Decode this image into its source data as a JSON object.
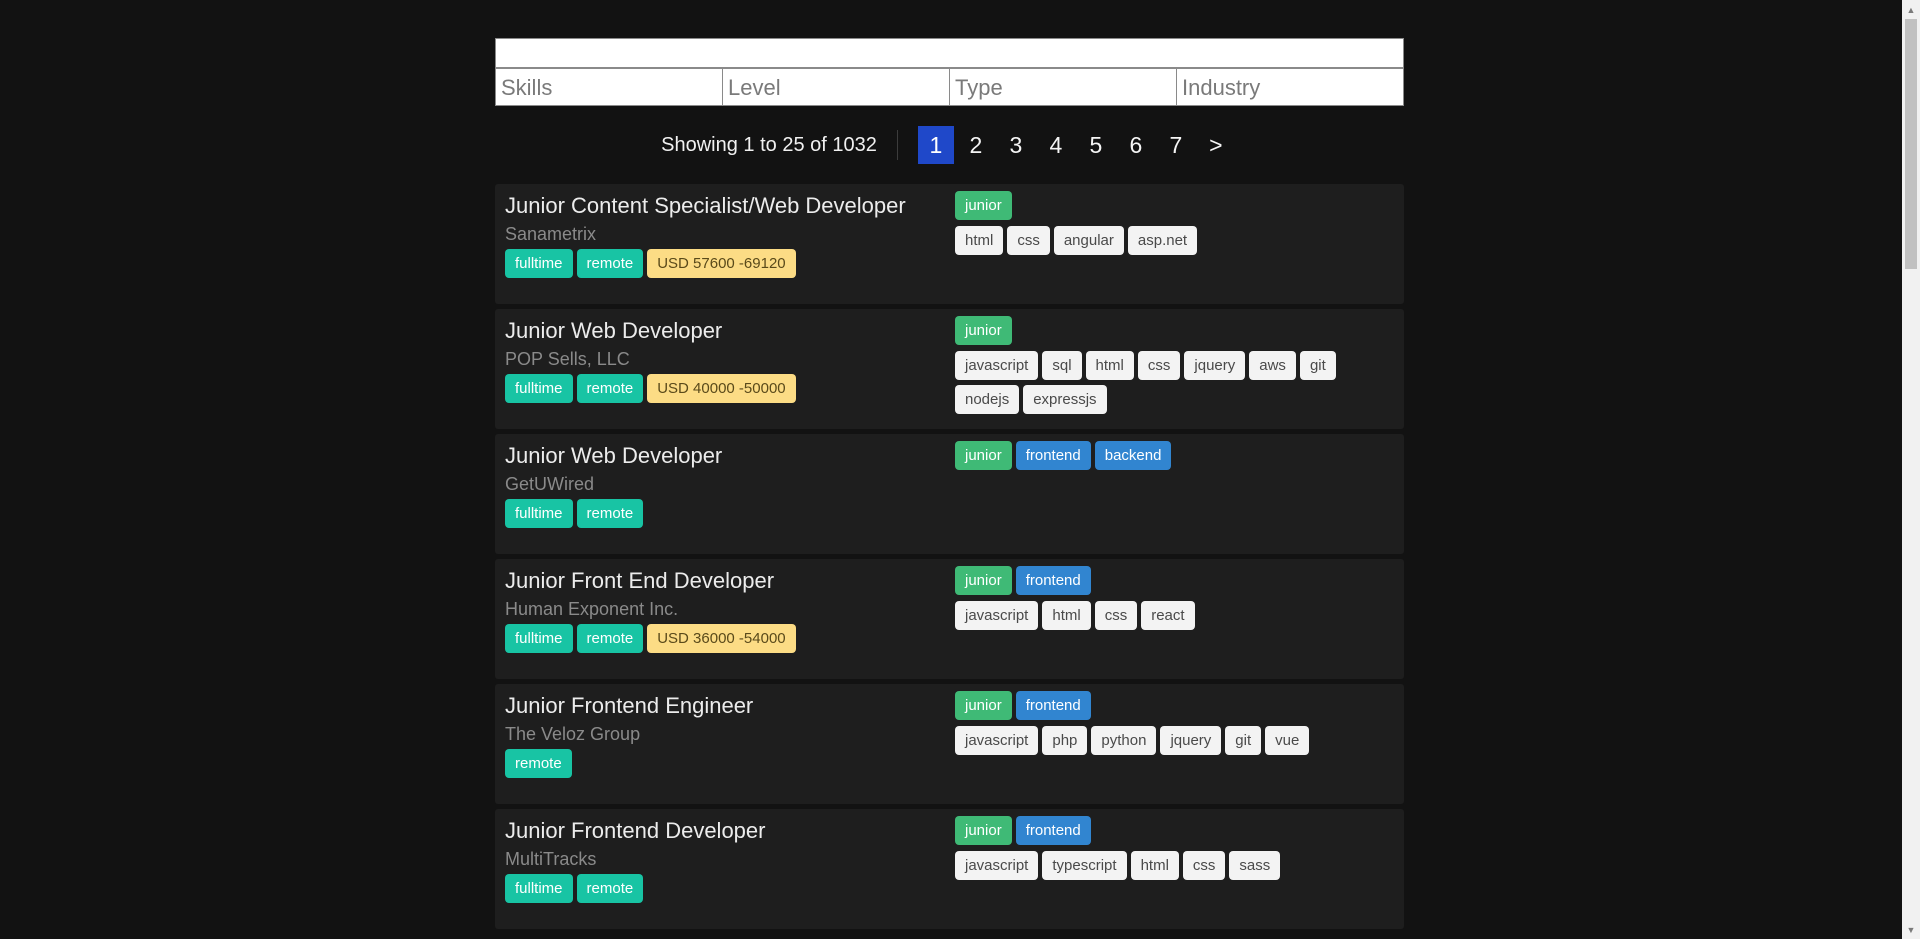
{
  "search": {
    "value": "",
    "placeholder": ""
  },
  "filters": [
    {
      "label": "Skills"
    },
    {
      "label": "Level"
    },
    {
      "label": "Type"
    },
    {
      "label": "Industry"
    }
  ],
  "pagination": {
    "showing": "Showing 1 to 25 of 1032",
    "pages": [
      "1",
      "2",
      "3",
      "4",
      "5",
      "6",
      "7"
    ],
    "current": "1",
    "next": ">"
  },
  "jobs": [
    {
      "title": "Junior Content Specialist/Web Developer",
      "company": "Sanametrix",
      "types": [
        "fulltime",
        "remote"
      ],
      "salary": "USD 57600 -69120",
      "levels": [
        "junior"
      ],
      "roles": [],
      "skills": [
        "html",
        "css",
        "angular",
        "asp.net"
      ]
    },
    {
      "title": "Junior Web Developer",
      "company": "POP Sells, LLC",
      "types": [
        "fulltime",
        "remote"
      ],
      "salary": "USD 40000 -50000",
      "levels": [
        "junior"
      ],
      "roles": [],
      "skills": [
        "javascript",
        "sql",
        "html",
        "css",
        "jquery",
        "aws",
        "git",
        "nodejs",
        "expressjs"
      ]
    },
    {
      "title": "Junior Web Developer",
      "company": "GetUWired",
      "types": [
        "fulltime",
        "remote"
      ],
      "salary": "",
      "levels": [
        "junior"
      ],
      "roles": [
        "frontend",
        "backend"
      ],
      "skills": []
    },
    {
      "title": "Junior Front End Developer",
      "company": "Human Exponent Inc.",
      "types": [
        "fulltime",
        "remote"
      ],
      "salary": "USD 36000 -54000",
      "levels": [
        "junior"
      ],
      "roles": [
        "frontend"
      ],
      "skills": [
        "javascript",
        "html",
        "css",
        "react"
      ]
    },
    {
      "title": "Junior Frontend Engineer",
      "company": "The Veloz Group",
      "types": [
        "remote"
      ],
      "salary": "",
      "levels": [
        "junior"
      ],
      "roles": [
        "frontend"
      ],
      "skills": [
        "javascript",
        "php",
        "python",
        "jquery",
        "git",
        "vue"
      ]
    },
    {
      "title": "Junior Frontend Developer",
      "company": "MultiTracks",
      "types": [
        "fulltime",
        "remote"
      ],
      "salary": "",
      "levels": [
        "junior"
      ],
      "roles": [
        "frontend"
      ],
      "skills": [
        "javascript",
        "typescript",
        "html",
        "css",
        "sass"
      ]
    }
  ],
  "colors": {
    "background": "#121212",
    "card": "#1e1e1e",
    "active_page": "#1f48c9",
    "type_tag": "#18c4a4",
    "salary_tag": "#fcdc85",
    "level_tag": "#3fba76",
    "role_tag": "#3185d0",
    "skill_tag": "#f3f3f3"
  }
}
